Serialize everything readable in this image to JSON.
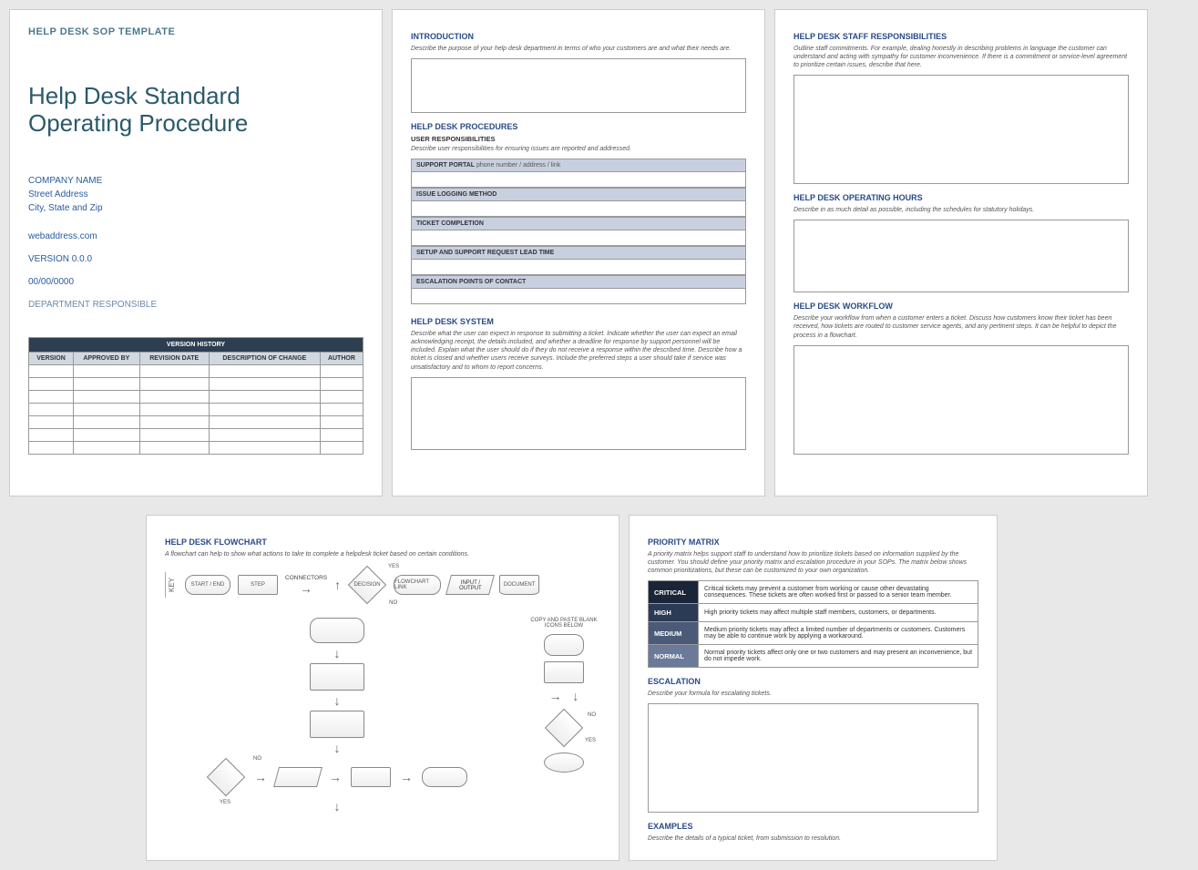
{
  "page1": {
    "template_label": "HELP DESK SOP TEMPLATE",
    "title_line1": "Help Desk Standard",
    "title_line2": "Operating Procedure",
    "company_name": "COMPANY NAME",
    "street": "Street Address",
    "city": "City, State and Zip",
    "web": "webaddress.com",
    "version": "VERSION 0.0.0",
    "date": "00/00/0000",
    "dept": "DEPARTMENT RESPONSIBLE",
    "vh_title": "VERSION HISTORY",
    "vh_cols": [
      "VERSION",
      "APPROVED BY",
      "REVISION DATE",
      "DESCRIPTION OF CHANGE",
      "AUTHOR"
    ]
  },
  "page2": {
    "intro_h": "INTRODUCTION",
    "intro_d": "Describe the purpose of your help desk department in terms of who your customers are and what their needs are.",
    "proc_h": "HELP DESK PROCEDURES",
    "user_resp_h": "USER RESPONSIBILITIES",
    "user_resp_d": "Describe user responsibilities for ensuring issues are reported and addressed.",
    "fields": [
      {
        "label": "SUPPORT PORTAL",
        "hint": " phone number / address / link"
      },
      {
        "label": "ISSUE LOGGING METHOD",
        "hint": ""
      },
      {
        "label": "TICKET COMPLETION",
        "hint": ""
      },
      {
        "label": "SETUP AND SUPPORT REQUEST LEAD TIME",
        "hint": ""
      },
      {
        "label": "ESCALATION POINTS OF CONTACT",
        "hint": ""
      }
    ],
    "sys_h": "HELP DESK SYSTEM",
    "sys_d": "Describe what the user can expect in response to submitting a ticket. Indicate whether the user can expect an email acknowledging receipt, the details included, and whether a deadline for response by support personnel will be included. Explain what the user should do if they do not receive a response within the described time. Describe how a ticket is closed and whether users receive surveys. Include the preferred steps a user should take if service was unsatisfactory and to whom to report concerns."
  },
  "page3": {
    "staff_h": "HELP DESK STAFF RESPONSIBILITIES",
    "staff_d": "Outline staff commitments. For example, dealing honestly in describing problems in language the customer can understand and acting with sympathy for customer inconvenience. If there is a commitment or service-level agreement to prioritize certain issues, describe that here.",
    "hours_h": "HELP DESK OPERATING HOURS",
    "hours_d": "Describe in as much detail as possible, including the schedules for statutory holidays.",
    "wf_h": "HELP DESK WORKFLOW",
    "wf_d": "Describe your workflow from when a customer enters a ticket. Discuss how customers know their ticket has been received, how tickets are routed to customer service agents, and any pertinent steps. It can be helpful to depict the process in a flowchart."
  },
  "page4": {
    "h": "HELP DESK FLOWCHART",
    "d": "A flowchart can help to show what actions to take to complete a helpdesk ticket based on certain conditions.",
    "key": "KEY",
    "k_start": "START / END",
    "k_step": "STEP",
    "k_conn": "CONNECTORS",
    "k_dec": "DECISION",
    "k_yes": "YES",
    "k_no": "NO",
    "k_link": "FLOWCHART LINK",
    "k_io": "INPUT / OUTPUT",
    "k_doc": "DOCUMENT",
    "copy_hint": "COPY AND PASTE BLANK ICONS BELOW"
  },
  "page5": {
    "pm_h": "PRIORITY MATRIX",
    "pm_d": "A priority matrix helps support staff to understand how to prioritize tickets based on information supplied by the customer. You should define your priority matrix and escalation procedure in your SOPs. The matrix below shows common prioritizations, but these can be customized to your own organization.",
    "rows": [
      {
        "level": "CRITICAL",
        "cls": "pc-critical",
        "desc": "Critical tickets may prevent a customer from working or cause other devastating consequences. These tickets are often worked first or passed to a senior team member."
      },
      {
        "level": "HIGH",
        "cls": "pc-high",
        "desc": "High priority tickets may affect multiple staff members, customers, or departments."
      },
      {
        "level": "MEDIUM",
        "cls": "pc-medium",
        "desc": "Medium priority tickets may affect a limited number of departments or customers. Customers may be able to continue work by applying a workaround."
      },
      {
        "level": "NORMAL",
        "cls": "pc-normal",
        "desc": "Normal priority tickets affect only one or two customers and may present an inconvenience, but do not impede work."
      }
    ],
    "esc_h": "ESCALATION",
    "esc_d": "Describe your formula for escalating tickets.",
    "ex_h": "EXAMPLES",
    "ex_d": "Describe the details of a typical ticket, from submission to resolution."
  }
}
